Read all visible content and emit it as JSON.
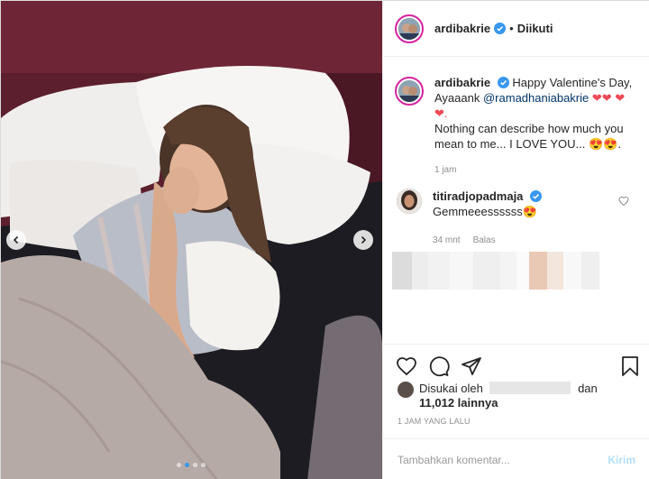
{
  "post": {
    "author": "ardibakrie",
    "separator": "•",
    "follow_state": "Diikuti"
  },
  "caption": {
    "author": "ardibakrie",
    "text_start": "Happy Valentine's Day, Ayaaank",
    "mention": "@ramadhaniabakrie",
    "hearts": "❤❤ ❤❤.",
    "text_second": "Nothing can describe how much you mean to me... I LOVE YOU...",
    "emoji_end": "😍😍.",
    "time": "1 jam"
  },
  "comment": {
    "author": "titiradjopadmaja",
    "text": "Gemmeeessssss",
    "emoji": "😍",
    "time": "34 mnt",
    "reply_label": "Balas"
  },
  "likes": {
    "prefix": "Disukai oleh",
    "connector": "dan",
    "count_text": "11,012 lainnya"
  },
  "posted_time": "1 JAM YANG LALU",
  "compose": {
    "placeholder": "Tambahkan komentar...",
    "send_label": "Kirim"
  },
  "icons": {
    "like": "heart-icon",
    "comment": "comment-icon",
    "share": "send-icon",
    "save": "bookmark-icon",
    "verified": "verified-badge-icon"
  },
  "colors": {
    "verified": "#3897f0",
    "heart": "#ed4956",
    "link": "#003569",
    "muted": "#8e8e8e",
    "send_disabled": "#b2dffc"
  },
  "carousel": {
    "slide_count": 4,
    "active_index": 1
  }
}
